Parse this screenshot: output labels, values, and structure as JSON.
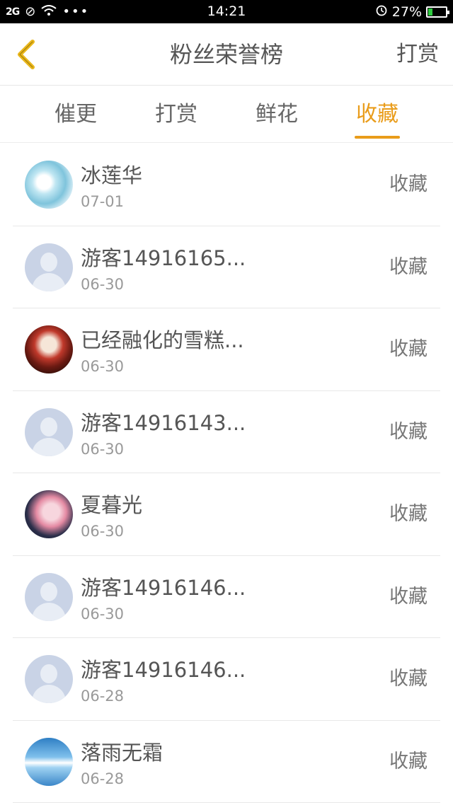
{
  "status_bar": {
    "signal": "2G",
    "time": "14:21",
    "battery": "27%",
    "battery_level": 0.27
  },
  "header": {
    "back_icon": "chevron-left-icon",
    "title": "粉丝荣誉榜",
    "action": "打赏"
  },
  "tabs": [
    {
      "label": "催更",
      "active": false
    },
    {
      "label": "打赏",
      "active": false
    },
    {
      "label": "鲜花",
      "active": false
    },
    {
      "label": "收藏",
      "active": true
    }
  ],
  "accent_color": "#e99c1a",
  "fans": [
    {
      "name": "冰莲华",
      "date": "07-01",
      "kind": "收藏",
      "avatar": "custom"
    },
    {
      "name": "游客14916165...",
      "date": "06-30",
      "kind": "收藏",
      "avatar": "default"
    },
    {
      "name": "已经融化的雪糕...",
      "date": "06-30",
      "kind": "收藏",
      "avatar": "custom"
    },
    {
      "name": "游客14916143...",
      "date": "06-30",
      "kind": "收藏",
      "avatar": "default"
    },
    {
      "name": "夏暮光",
      "date": "06-30",
      "kind": "收藏",
      "avatar": "custom"
    },
    {
      "name": "游客14916146...",
      "date": "06-30",
      "kind": "收藏",
      "avatar": "default"
    },
    {
      "name": "游客14916146...",
      "date": "06-28",
      "kind": "收藏",
      "avatar": "default"
    },
    {
      "name": "落雨无霜",
      "date": "06-28",
      "kind": "收藏",
      "avatar": "custom"
    }
  ]
}
